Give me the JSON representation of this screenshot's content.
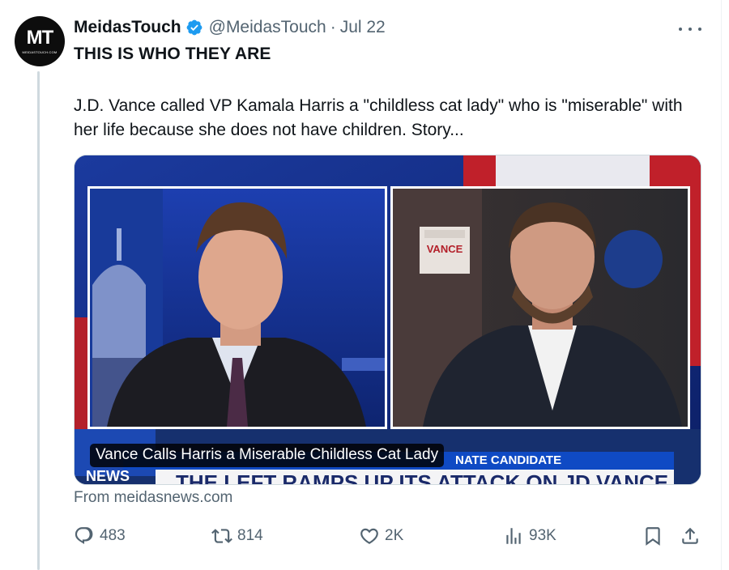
{
  "post": {
    "author": {
      "avatar_text": "MT",
      "avatar_subtext": "MEIDASTOUCH.COM",
      "display_name": "MeidasTouch",
      "verified": true,
      "handle": "@MeidasTouch",
      "separator": "·",
      "date": "Jul 22"
    },
    "headline": "THIS IS WHO THEY ARE",
    "text": "J.D. Vance called VP Kamala Harris a \"childless cat lady\" who is \"miserable\" with her life because she does not have children. Story...",
    "media": {
      "caption": "Vance Calls Harris a Miserable Childless Cat Lady",
      "chyron_label": "NATE CANDIDATE",
      "chyron_headline": "THE LEFT RAMPS UP ITS ATTACK ON JD VANCE",
      "network_label": "NEWS",
      "sign_text": "VANCE"
    },
    "link_source": "From meidasnews.com",
    "stats": {
      "replies": "483",
      "reposts": "814",
      "likes": "2K",
      "views": "93K"
    }
  },
  "icons": {
    "more": "more-dots-icon",
    "verified": "verified-badge-icon",
    "reply": "reply-icon",
    "repost": "repost-icon",
    "like": "heart-icon",
    "views": "views-icon",
    "bookmark": "bookmark-icon",
    "share": "share-icon"
  },
  "colors": {
    "verified": "#1d9bf0",
    "muted_text": "#536471",
    "border": "#cfd9de"
  }
}
